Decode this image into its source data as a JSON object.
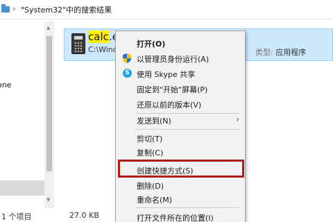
{
  "address_bar": {
    "breadcrumb": "\"System32\"中的搜索结果"
  },
  "nav": {
    "partial_label": "one"
  },
  "result": {
    "name_highlight": "calc",
    "name_rest": ".exe",
    "path": "C:\\Windo",
    "type_label": "类型:",
    "type_value": "应用程序"
  },
  "status": {
    "count": "1 个项目",
    "size": "27.0 KB"
  },
  "context_menu": {
    "items": [
      {
        "label": "打开(O)"
      },
      {
        "label": "以管理员身份运行(A)"
      },
      {
        "label": "使用 Skype 共享"
      },
      {
        "label": "固定到\"开始\"屏幕(P)"
      },
      {
        "label": "还原以前的版本(V)"
      },
      {
        "label": "发送到(N)"
      },
      {
        "label": "剪切(T)"
      },
      {
        "label": "复制(C)"
      },
      {
        "label": "创建快捷方式(S)"
      },
      {
        "label": "删除(D)"
      },
      {
        "label": "重命名(M)"
      },
      {
        "label": "打开文件所在的位置(I)"
      }
    ],
    "highlighted": "创建快捷方式(S)",
    "highlight_color": "#b01c1c"
  },
  "colors": {
    "selection": "#cce8ff",
    "menu_bg": "#f2f2f2",
    "search_hit": "#fff200"
  },
  "icons": [
    "folder-icon",
    "calculator-icon",
    "uac-shield-icon",
    "skype-icon",
    "chevron-right-icon"
  ]
}
